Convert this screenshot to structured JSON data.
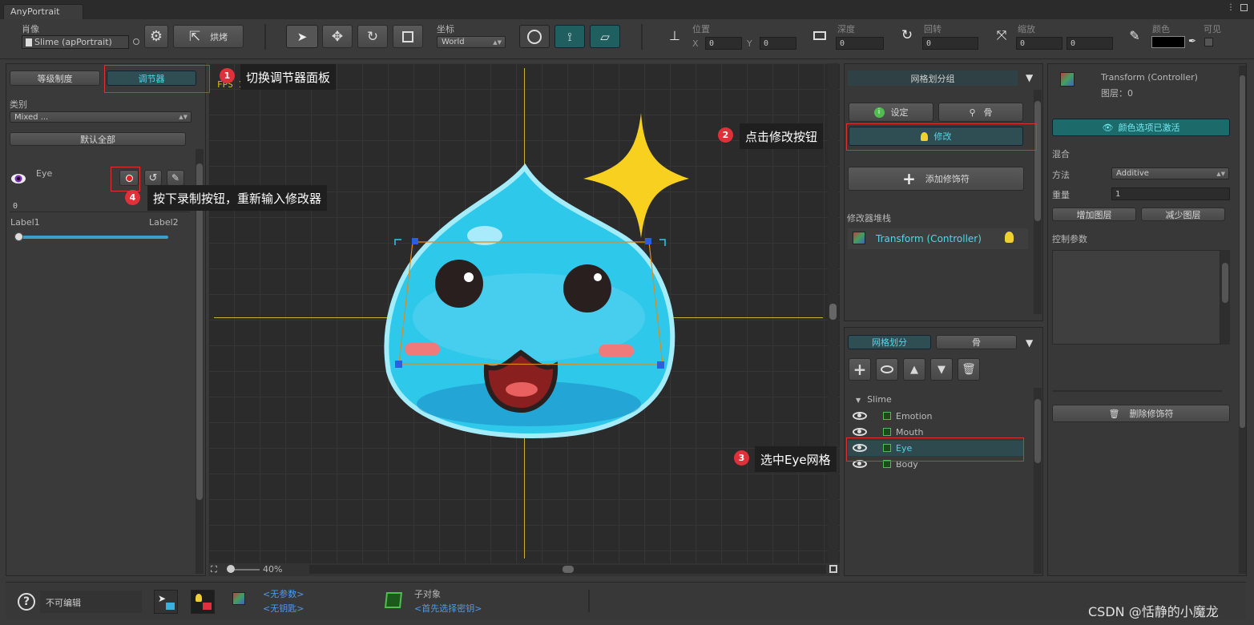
{
  "window": {
    "tab_title": "AnyPortrait"
  },
  "toolbar": {
    "portrait_label": "肖像",
    "portrait_value": "Slime (apPortrait)",
    "bake_label": "烘烤",
    "coord_label": "坐标",
    "coord_value": "World",
    "position_label": "位置",
    "pos_x_label": "X",
    "pos_x": "0",
    "pos_y_label": "Y",
    "pos_y": "0",
    "depth_label": "深度",
    "depth": "0",
    "rotation_label": "回转",
    "rotation": "0",
    "scale_label": "缩放",
    "scale_x": "0",
    "scale_y": "0",
    "color_label": "颜色",
    "visible_label": "可见"
  },
  "left": {
    "tab_hierarchy": "等级制度",
    "tab_controller": "调节器",
    "category_label": "类别",
    "category_value": "Mixed ...",
    "default_all": "默认全部",
    "controller_name": "Eye",
    "slider_value": "0",
    "slider_label1": "Label1",
    "slider_label2": "Label2",
    "slider_fraction": 0.0
  },
  "canvas": {
    "fps": "FPS 102",
    "zoom": "40%"
  },
  "mesh_group": {
    "header": "网格划分组",
    "setting_btn": "设定",
    "bone_btn": "骨",
    "modify_btn": "修改",
    "add_modifier_btn": "添加修饰符",
    "stack_label": "修改器堆栈",
    "modifier_item": "Transform (Controller)"
  },
  "mesh_list": {
    "tab_mesh": "网格划分",
    "tab_bone": "骨",
    "root": "Slime",
    "items": [
      "Emotion",
      "Mouth",
      "Eye",
      "Body"
    ],
    "selected": "Eye"
  },
  "right": {
    "title": "Transform (Controller)",
    "layer": "图层：0",
    "color_option_btn": "颜色选项已激活",
    "blend_label": "混合",
    "method_label": "方法",
    "method_value": "Additive",
    "weight_label": "重量",
    "weight_value": "1",
    "add_layer_btn": "增加图层",
    "remove_layer_btn": "减少图层",
    "control_params_label": "控制参数",
    "delete_modifier_btn": "删除修饰符"
  },
  "bottom": {
    "not_editable": "不可编辑",
    "no_param": "<无参数>",
    "no_key": "<无钥匙>",
    "child_label": "子对象",
    "select_key_first": "<首先选择密钥>"
  },
  "annotations": {
    "step1": "切换调节器面板",
    "step2": "点击修改按钮",
    "step3": "选中Eye网格",
    "step4": "按下录制按钮，重新输入修改器",
    "n1": "1",
    "n2": "2",
    "n3": "3",
    "n4": "4"
  },
  "watermark": "CSDN @恬静的小魔龙",
  "colors": {
    "accent_teal": "#1f5f5f",
    "highlight_text": "#4fd8e8",
    "annotation_red": "#e03030"
  }
}
